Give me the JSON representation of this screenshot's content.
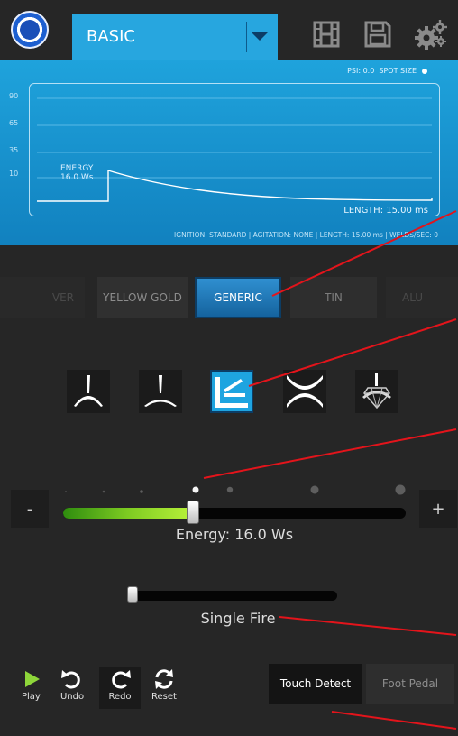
{
  "header": {
    "mode": "BASIC"
  },
  "graph": {
    "psi": "PSI: 0.0",
    "spot": "SPOT SIZE",
    "y_ticks": [
      "90",
      "65",
      "35",
      "10"
    ],
    "energy_title": "ENERGY",
    "energy_value": "16.0 Ws",
    "length": "LENGTH: 15.00 ms",
    "footer": "IGNITION: STANDARD | AGITATION: NONE | LENGTH: 15.00 ms | WELDS/SEC: 0"
  },
  "metals": [
    {
      "label": "VER",
      "active": false
    },
    {
      "label": "YELLOW GOLD",
      "active": false
    },
    {
      "label": "GENERIC",
      "active": true
    },
    {
      "label": "TIN",
      "active": false
    },
    {
      "label": "ALU",
      "active": false
    }
  ],
  "energy_slider": {
    "minus": "-",
    "plus": "+",
    "label": "Energy: 16.0 Ws",
    "value_fraction": 0.38
  },
  "fire_mode": {
    "label": "Single Fire",
    "value_fraction": 0.0
  },
  "controls": {
    "play": "Play",
    "undo": "Undo",
    "redo": "Redo",
    "reset": "Reset",
    "touch_detect": "Touch Detect",
    "foot_pedal": "Foot Pedal"
  },
  "colors": {
    "accent": "#27a6df",
    "annotation": "#e3141b",
    "energy_fill": "#7ecb22"
  }
}
